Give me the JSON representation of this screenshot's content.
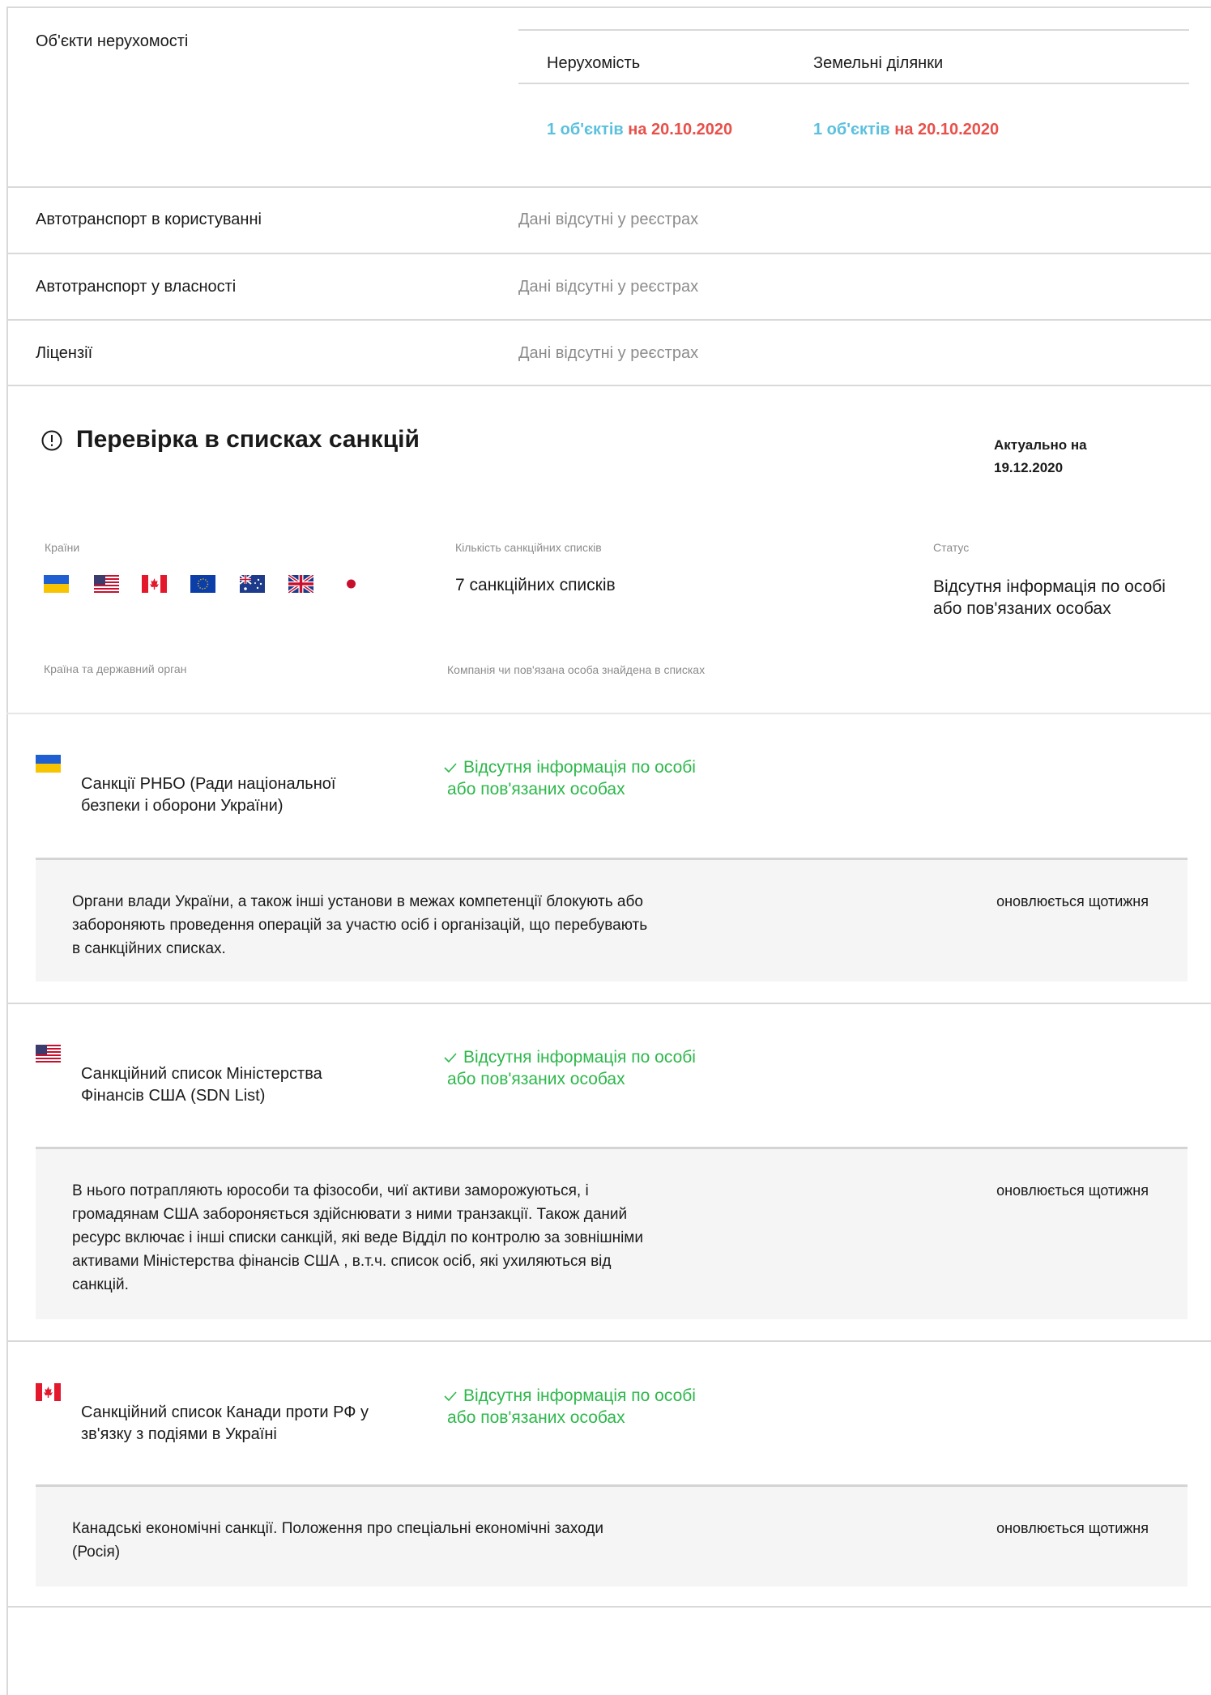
{
  "property": {
    "label": "Об'єкти нерухомості",
    "columns": [
      {
        "header": "Нерухомість",
        "count": "1 об'єктів",
        "date": "на 20.10.2020"
      },
      {
        "header": "Земельні ділянки",
        "count": "1 об'єктів",
        "date": "на 20.10.2020"
      }
    ]
  },
  "registry_rows": [
    {
      "label": "Автотранспорт в користуванні",
      "value": "Дані відсутні у реєстрах"
    },
    {
      "label": "Автотранспорт у власності",
      "value": "Дані відсутні у реєстрах"
    },
    {
      "label": "Ліцензії",
      "value": "Дані відсутні у реєстрах"
    }
  ],
  "sanctions": {
    "title": "Перевірка в списках санкцій",
    "actual_label": "Актуально на",
    "actual_date": "19.12.2020",
    "countries_label": "Країни",
    "lists_count_label": "Кількість санкційних списків",
    "status_label": "Статус",
    "lists_count": "7 санкційних списків",
    "status": "Відсутня інформація по особі або пов'язаних особах",
    "flags": [
      "ukraine-flag",
      "usa-flag",
      "canada-flag",
      "eu-flag",
      "australia-flag",
      "uk-flag",
      "japan-flag"
    ],
    "col_country_label": "Країна та державний орган",
    "col_found_label": "Компанія чи пов'язана особа знайдена в списках",
    "items": [
      {
        "flag": "ukraine-flag",
        "name": "Санкції РНБО (Ради національної безпеки і оборони України)",
        "result": "Відсутня інформація по особі або пов'язаних особах",
        "description": "Органи влади України, а також інші установи в межах компетенції блокують або забороняють проведення операцій за участю осіб і організацій, що перебувають в санкційних списках.",
        "update": "оновлюється щотижня"
      },
      {
        "flag": "usa-flag",
        "name": "Санкційний список Міністерства Фінансів США (SDN List)",
        "result": "Відсутня інформація по особі або пов'язаних особах",
        "description": "В нього потрапляють юрособи та фізособи, чиї активи заморожуються, і громадянам США забороняється здійснювати з ними транзакції. Також даний ресурс включає і інші списки санкцій, які веде Відділ по контролю за зовнішніми активами Міністерства фінансів США , в.т.ч. список осіб, які ухиляються від санкцій.",
        "update": "оновлюється щотижня"
      },
      {
        "flag": "canada-flag",
        "name": "Санкційний список Канади проти РФ у зв'язку з подіями в Україні",
        "result": "Відсутня інформація по особі або пов'язаних особах",
        "description": "Канадські економічні санкції. Положення про спеціальні економічні заходи (Росія)",
        "update": "оновлюється щотижня"
      }
    ]
  },
  "colors": {
    "cyan": "#5bc0de",
    "red": "#e8504a",
    "green": "#2db84b",
    "border": "#d9d9d9"
  }
}
